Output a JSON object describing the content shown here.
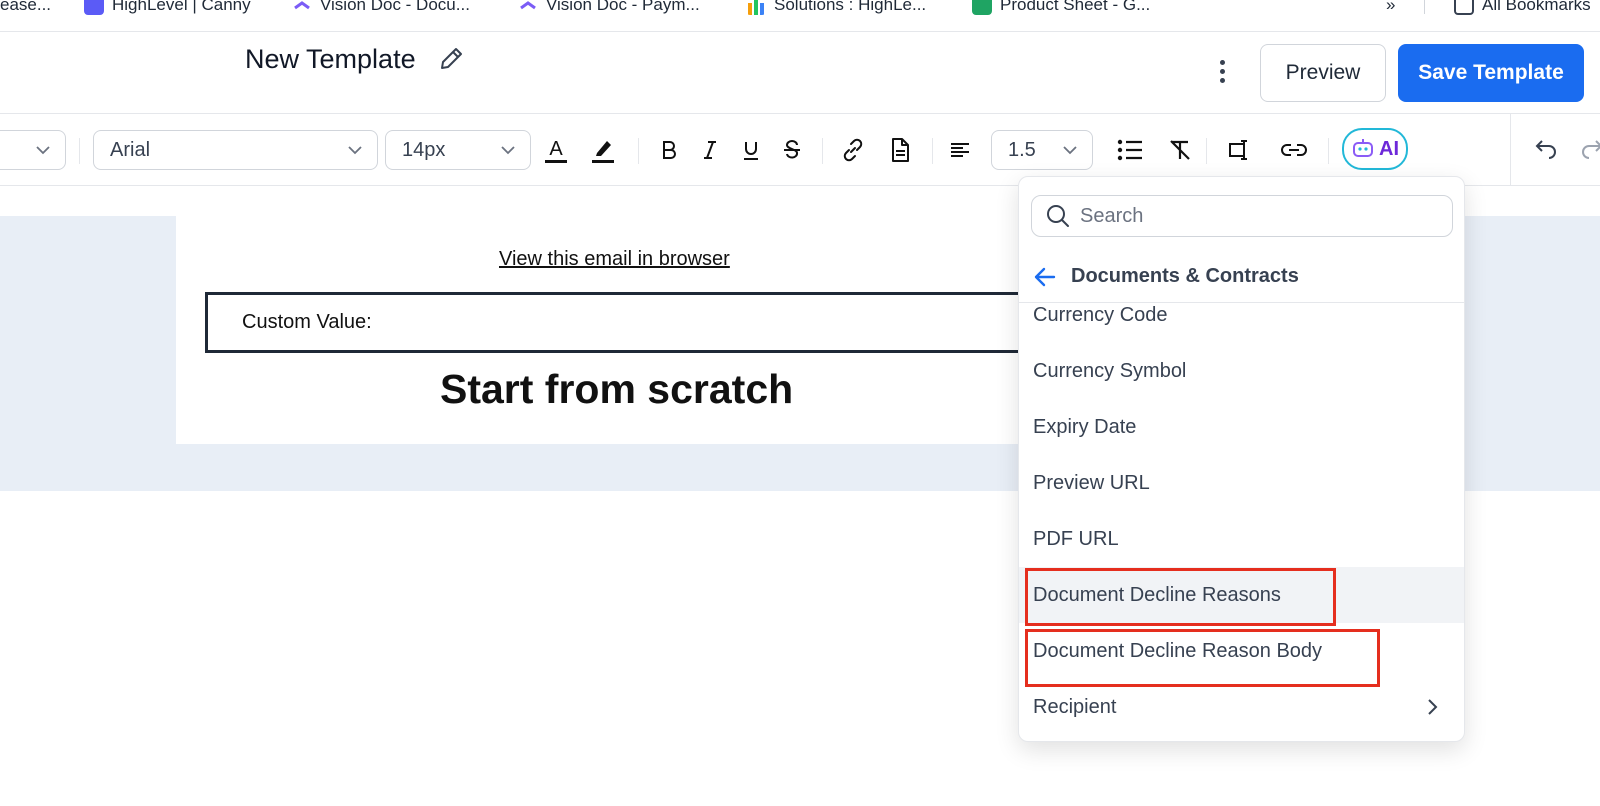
{
  "bookmarks": [
    {
      "label": "ease...",
      "icon": "none"
    },
    {
      "label": "HighLevel | Canny",
      "icon": "canny-icon",
      "color": "#5b5bf6"
    },
    {
      "label": "Vision Doc - Docu...",
      "icon": "clickup-icon"
    },
    {
      "label": "Vision Doc - Paym...",
      "icon": "clickup-icon"
    },
    {
      "label": "Solutions : HighLe...",
      "icon": "highlevel-icon"
    },
    {
      "label": "Product Sheet - G...",
      "icon": "sheets-icon",
      "color": "#1fa463"
    },
    {
      "label": "All Bookmarks",
      "icon": "folder-icon"
    }
  ],
  "header": {
    "title": "New Template",
    "preview_label": "Preview",
    "save_label": "Save Template"
  },
  "toolbar": {
    "font_family": "Arial",
    "font_size": "14px",
    "line_height": "1.5",
    "ai_label": "AI"
  },
  "editor": {
    "view_link": "View this email in browser",
    "custom_value_label": "Custom Value:",
    "heading": "Start from scratch"
  },
  "dropdown": {
    "search_placeholder": "Search",
    "category_title": "Documents & Contracts",
    "items": [
      {
        "label": "Currency Code"
      },
      {
        "label": "Currency Symbol"
      },
      {
        "label": "Expiry Date"
      },
      {
        "label": "Preview URL"
      },
      {
        "label": "PDF URL"
      },
      {
        "label": "Document Decline Reasons",
        "highlighted": true
      },
      {
        "label": "Document Decline Reason Body",
        "highlighted": true
      },
      {
        "label": "Recipient",
        "has_submenu": true
      }
    ]
  },
  "colors": {
    "primary": "#1a6cf0",
    "highlight": "#e52e1e",
    "ai_accent": "#6d28d9"
  }
}
